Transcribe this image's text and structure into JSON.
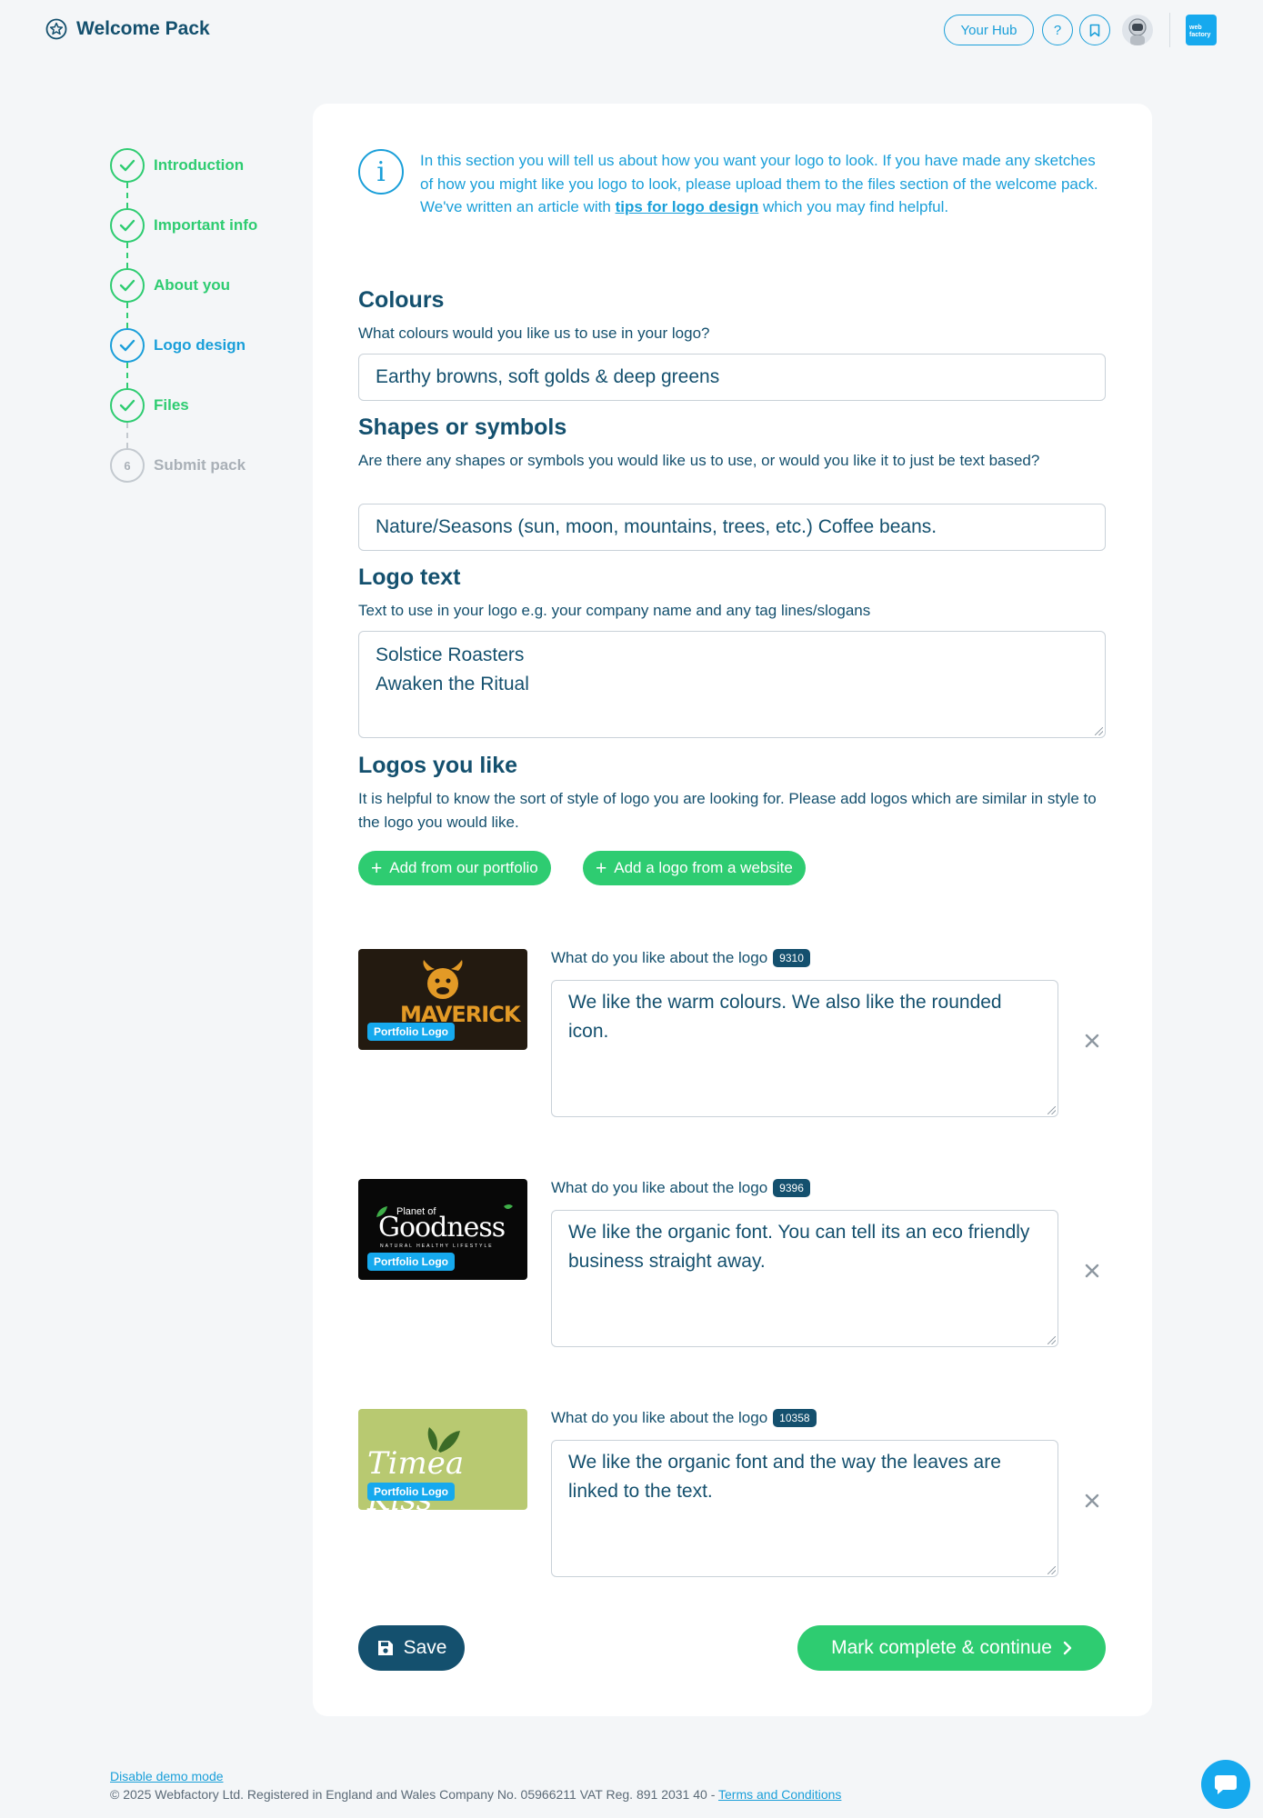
{
  "header": {
    "title": "Welcome Pack",
    "hub_label": "Your Hub",
    "help_symbol": "?",
    "brand_mark": "web factory"
  },
  "steps": [
    {
      "label": "Introduction",
      "state": "complete"
    },
    {
      "label": "Important info",
      "state": "complete"
    },
    {
      "label": "About you",
      "state": "complete"
    },
    {
      "label": "Logo design",
      "state": "current"
    },
    {
      "label": "Files",
      "state": "complete"
    },
    {
      "label": "Submit pack",
      "state": "pending",
      "number": "6"
    }
  ],
  "info": {
    "text_before": "In this section you will tell us about how you want your logo to look. If you have made any sketches of how you might like you logo to look, please upload them to the files section of the welcome pack. We've written an article with ",
    "link": "tips for logo design",
    "text_after": " which you may find helpful."
  },
  "colours": {
    "title": "Colours",
    "desc": "What colours would you like us to use in your logo?",
    "value": "Earthy browns, soft golds & deep greens"
  },
  "shapes": {
    "title": "Shapes or symbols",
    "desc": "Are there any shapes or symbols you would like us to use, or would you like it to just be text based?",
    "value": "Nature/Seasons (sun, moon, mountains, trees, etc.) Coffee beans."
  },
  "logo_text": {
    "title": "Logo text",
    "desc": "Text to use in your logo e.g. your company name and any tag lines/slogans",
    "line1": "Solstice Roasters",
    "line2": "Awaken the Ritual"
  },
  "logos_like": {
    "title": "Logos you like",
    "desc": "It is helpful to know the sort of style of logo you are looking for. Please add logos which are similar in style to the logo you would like.",
    "add_portfolio": "Add from our portfolio",
    "add_website": "Add a logo from a website",
    "items": [
      {
        "badge": "Portfolio Logo",
        "label": "What do you like about the logo",
        "id": "9310",
        "comment": "We like the warm colours. We also like the rounded icon.",
        "thumb_text": "MAVERICK"
      },
      {
        "badge": "Portfolio Logo",
        "label": "What do you like about the logo",
        "id": "9396",
        "comment": "We like the organic font. You can tell its an eco friendly business straight away.",
        "thumb_text_small": "Planet of",
        "thumb_text": "Goodness",
        "thumb_tagline": "NATURAL HEALTHY LIFESTYLE"
      },
      {
        "badge": "Portfolio Logo",
        "label": "What do you like about the logo",
        "id": "10358",
        "comment": "We like the organic font and the way the leaves are linked to the text.",
        "thumb_text": "Timea Kiss"
      }
    ]
  },
  "actions": {
    "save": "Save",
    "continue": "Mark complete & continue"
  },
  "footer": {
    "demo_link": "Disable demo mode",
    "legal": "© 2025 Webfactory Ltd. Registered in England and Wales Company No. 05966211 VAT Reg. 891 2031 40 - ",
    "terms": "Terms and Conditions"
  },
  "colors": {
    "primary": "#14506e",
    "accent": "#1a9fd9",
    "success": "#2ecc71"
  }
}
